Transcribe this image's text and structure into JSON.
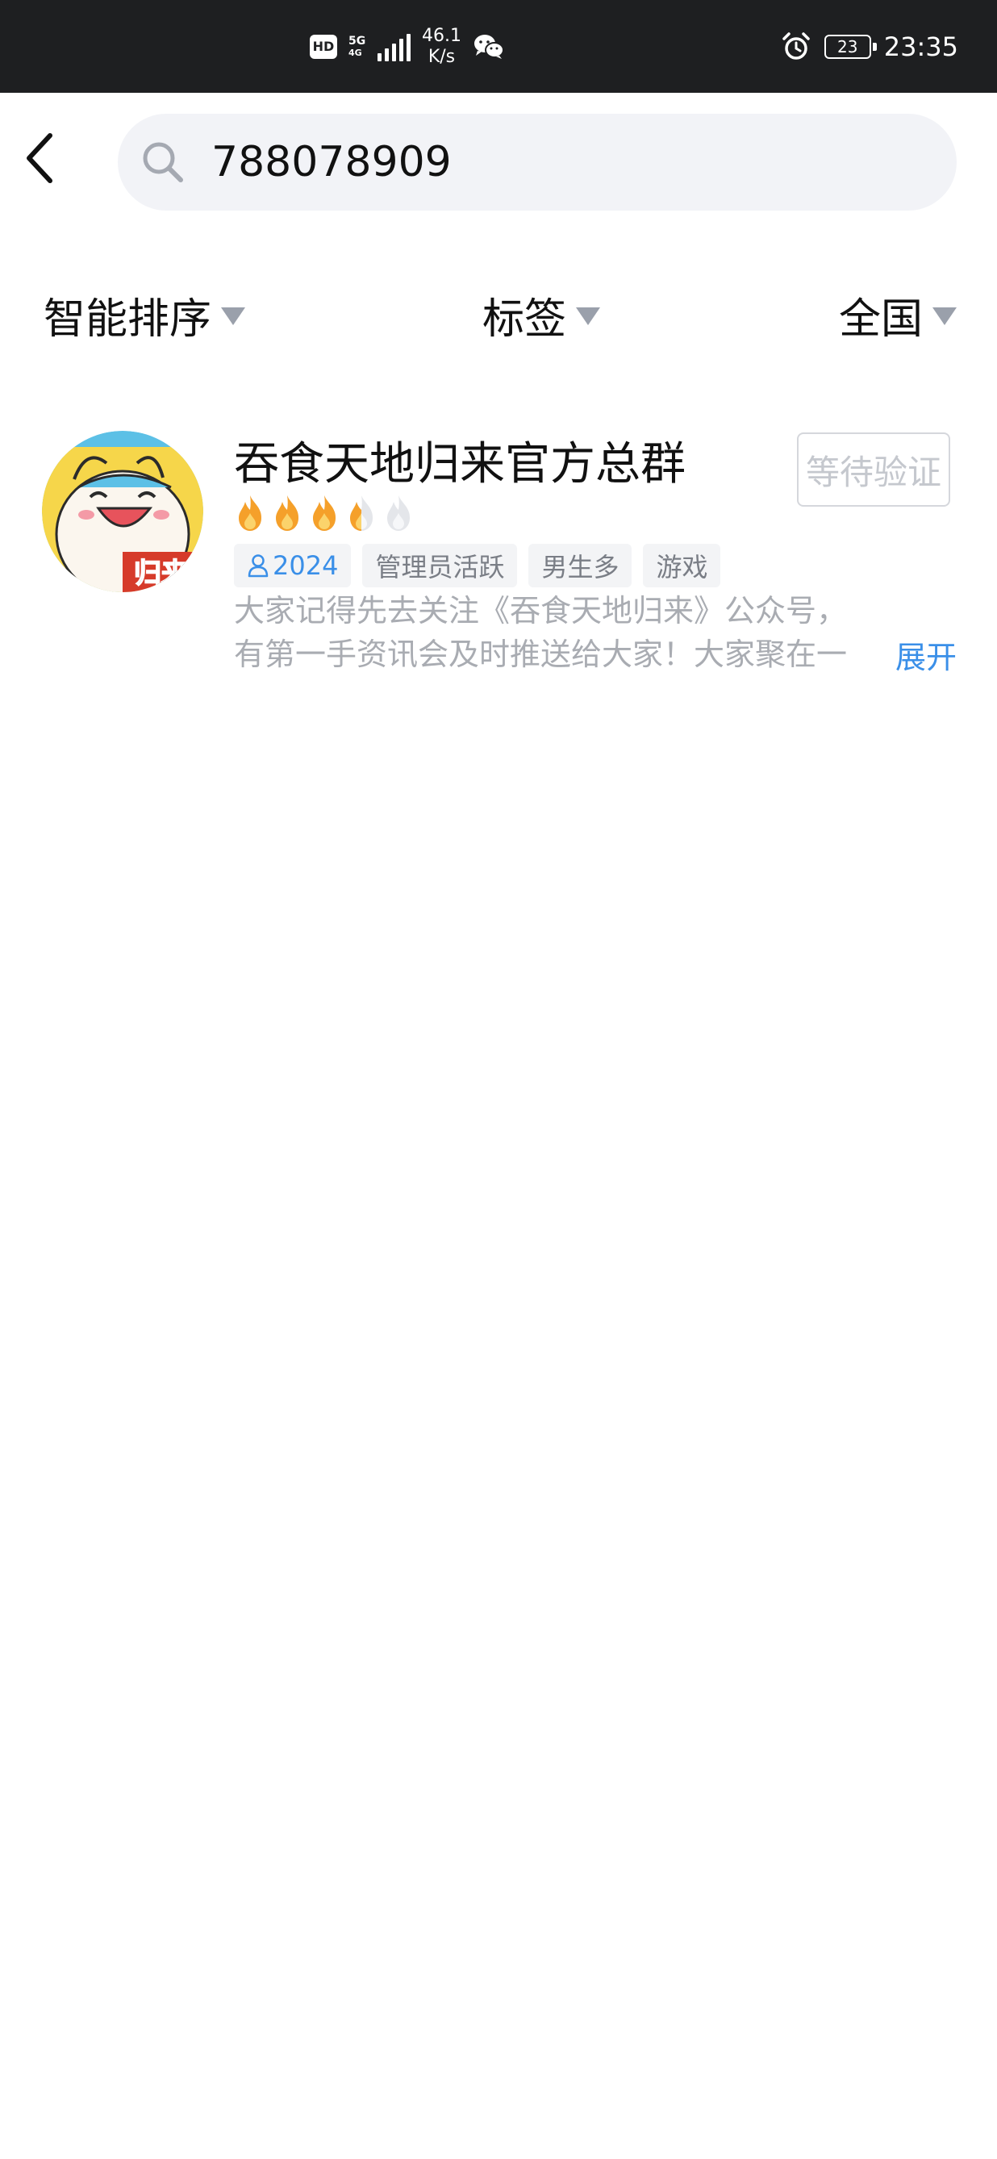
{
  "status_bar": {
    "hd_label": "HD",
    "network_type_top": "5G",
    "network_type_bottom": "4G",
    "speed_value": "46.1",
    "speed_unit": "K/s",
    "battery_level": "23",
    "time": "23:35",
    "icons": [
      "hd-icon",
      "signal-icon",
      "wechat-icon",
      "alarm-icon",
      "battery-icon"
    ]
  },
  "search": {
    "query": "788078909",
    "icon": "search-icon",
    "back_icon": "back-arrow-icon"
  },
  "filters": {
    "sort_label": "智能排序",
    "tag_label": "标签",
    "region_label": "全国",
    "icon": "caret-down-icon"
  },
  "result": {
    "name": "吞食天地归来官方总群",
    "heat_level": 3.5,
    "heat_max": 5,
    "member_count": "2024",
    "tags": [
      "管理员活跃",
      "男生多",
      "游戏"
    ],
    "description": "大家记得先去关注《吞食天地归来》公众号，有第一手资讯会及时推送给大家！大家聚在一起",
    "expand_label": "展开",
    "status_button_label": "等待验证",
    "avatar_text": "归来"
  },
  "colors": {
    "status_bar_bg": "#1e1f21",
    "accent_blue": "#3a8fe8",
    "flame_orange": "#f5a02a",
    "search_bg": "#f2f3f7"
  }
}
